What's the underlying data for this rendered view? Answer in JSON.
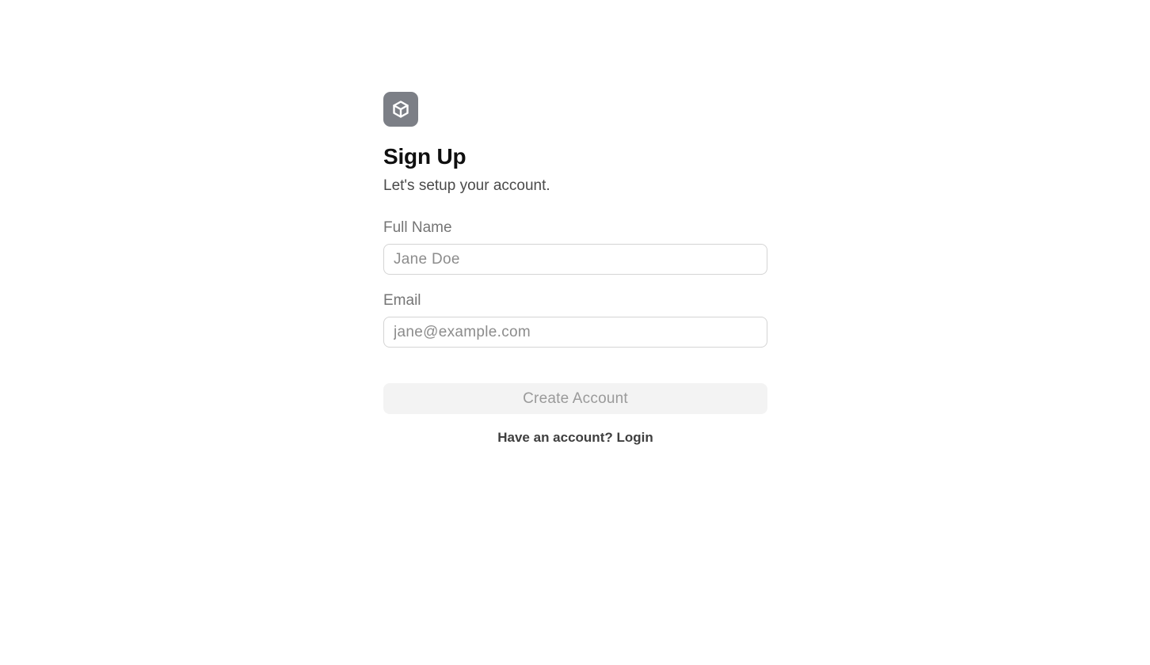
{
  "brand": {
    "logo_icon": "box-icon",
    "logo_bg_color": "#7c7f86"
  },
  "heading": {
    "title": "Sign Up",
    "subtitle": "Let's setup your account."
  },
  "form": {
    "full_name": {
      "label": "Full Name",
      "placeholder": "Jane Doe",
      "value": ""
    },
    "email": {
      "label": "Email",
      "placeholder": "jane@example.com",
      "value": ""
    },
    "submit": {
      "label": "Create Account",
      "disabled": true
    }
  },
  "footer": {
    "login_link_text": "Have an account? Login"
  }
}
